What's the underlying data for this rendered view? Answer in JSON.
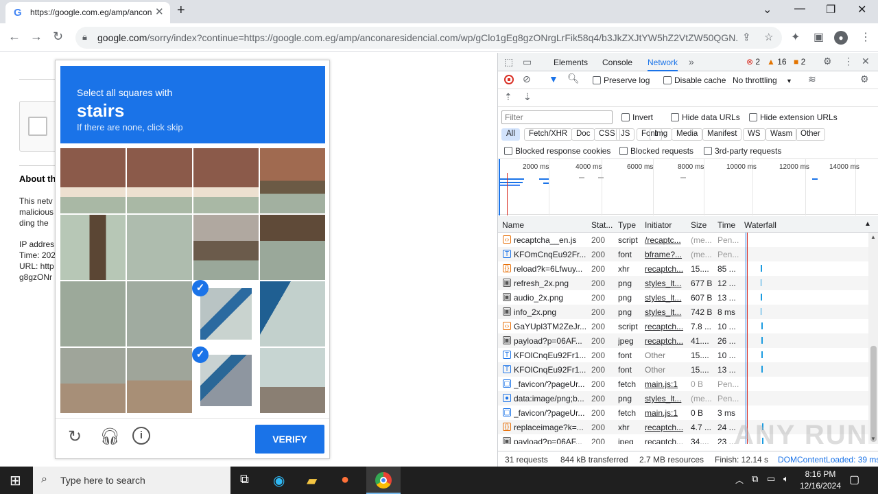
{
  "browser": {
    "tab_title": "https://google.com.eg/amp/anconaresidencial.com",
    "tab_favicon": "G",
    "url_host": "google.com",
    "url_rest": "/sorry/index?continue=https://google.com.eg/amp/anconaresidencial.com/wp/gClo1gEg8gzONrgLrFik58q4/b3JkZXJtYW5hZ2VtZW50QGN...",
    "accent": "#1a73e8"
  },
  "page": {
    "about_title": "About th",
    "lines": [
      "This netv",
      "malicious",
      "ding the",
      "IP addres",
      "Time: 202",
      "URL: http",
      "g8gzONr"
    ]
  },
  "captcha": {
    "line1": "Select all squares with",
    "keyword": "stairs",
    "line3": "If there are none, click skip",
    "verify_label": "VERIFY",
    "selected_tiles": [
      10,
      14
    ]
  },
  "devtools": {
    "tabs": [
      "Elements",
      "Console",
      "Network"
    ],
    "errors": "2",
    "warnings": "16",
    "issues": "2",
    "preserve_log": "Preserve log",
    "disable_cache": "Disable cache",
    "throttling": "No throttling",
    "filter_placeholder": "Filter",
    "invert": "Invert",
    "hide_data_urls": "Hide data URLs",
    "hide_ext_urls": "Hide extension URLs",
    "chips": [
      "All",
      "Fetch/XHR",
      "Doc",
      "CSS",
      "JS",
      "Font",
      "Img",
      "Media",
      "Manifest",
      "WS",
      "Wasm",
      "Other"
    ],
    "blocked_cookies": "Blocked response cookies",
    "blocked_requests": "Blocked requests",
    "third_party": "3rd-party requests",
    "timeline_ticks": [
      "2000 ms",
      "4000 ms",
      "6000 ms",
      "8000 ms",
      "10000 ms",
      "12000 ms",
      "14000 ms"
    ],
    "columns": [
      "Name",
      "Stat...",
      "Type",
      "Initiator",
      "Size",
      "Time",
      "Waterfall"
    ],
    "rows": [
      {
        "icon": "script",
        "name": "recaptcha__en.js",
        "status": "200",
        "type": "script",
        "initiator": "/recaptc...",
        "size": "(me...",
        "time": "Pen...",
        "link": true,
        "grey": true
      },
      {
        "icon": "font",
        "name": "KFOmCnqEu92Fr...",
        "status": "200",
        "type": "font",
        "initiator": "bframe?...",
        "size": "(me...",
        "time": "Pen...",
        "link": true,
        "grey": true
      },
      {
        "icon": "xhr",
        "name": "reload?k=6Lfwuy...",
        "status": "200",
        "type": "xhr",
        "initiator": "recaptch...",
        "size": "15....",
        "time": "85 ...",
        "link": true,
        "grey": false
      },
      {
        "icon": "img",
        "name": "refresh_2x.png",
        "status": "200",
        "type": "png",
        "initiator": "styles_lt...",
        "size": "677 B",
        "time": "12 ...",
        "link": true,
        "grey": false
      },
      {
        "icon": "img",
        "name": "audio_2x.png",
        "status": "200",
        "type": "png",
        "initiator": "styles_lt...",
        "size": "607 B",
        "time": "13 ...",
        "link": true,
        "grey": false
      },
      {
        "icon": "img",
        "name": "info_2x.png",
        "status": "200",
        "type": "png",
        "initiator": "styles_lt...",
        "size": "742 B",
        "time": "8 ms",
        "link": true,
        "grey": false
      },
      {
        "icon": "script",
        "name": "GaYUpl3TM2ZeJr...",
        "status": "200",
        "type": "script",
        "initiator": "recaptch...",
        "size": "7.8 ...",
        "time": "10 ...",
        "link": true,
        "grey": false
      },
      {
        "icon": "img",
        "name": "payload?p=06AF...",
        "status": "200",
        "type": "jpeg",
        "initiator": "recaptch...",
        "size": "41....",
        "time": "26 ...",
        "link": true,
        "grey": false
      },
      {
        "icon": "font",
        "name": "KFOlCnqEu92Fr1...",
        "status": "200",
        "type": "font",
        "initiator": "Other",
        "size": "15....",
        "time": "10 ...",
        "link": false,
        "grey": false
      },
      {
        "icon": "font",
        "name": "KFOlCnqEu92Fr1...",
        "status": "200",
        "type": "font",
        "initiator": "Other",
        "size": "15....",
        "time": "13 ...",
        "link": false,
        "grey": false
      },
      {
        "icon": "doc",
        "name": "_favicon/?pageUr...",
        "status": "200",
        "type": "fetch",
        "initiator": "main.js:1",
        "size": "0 B",
        "time": "Pen...",
        "link": true,
        "grey": true
      },
      {
        "icon": "data",
        "name": "data:image/png;b...",
        "status": "200",
        "type": "png",
        "initiator": "styles_lt...",
        "size": "(me...",
        "time": "Pen...",
        "link": true,
        "grey": true
      },
      {
        "icon": "doc",
        "name": "_favicon/?pageUr...",
        "status": "200",
        "type": "fetch",
        "initiator": "main.js:1",
        "size": "0 B",
        "time": "3 ms",
        "link": true,
        "grey": false
      },
      {
        "icon": "xhr",
        "name": "replaceimage?k=...",
        "status": "200",
        "type": "xhr",
        "initiator": "recaptch...",
        "size": "4.7 ...",
        "time": "24 ...",
        "link": true,
        "grey": false
      },
      {
        "icon": "img",
        "name": "payload?p=06AF...",
        "status": "200",
        "type": "jpeg",
        "initiator": "recaptch...",
        "size": "34....",
        "time": "23 ...",
        "link": true,
        "grey": false
      }
    ],
    "status": {
      "requests": "31 requests",
      "transferred": "844 kB transferred",
      "resources": "2.7 MB resources",
      "finish": "Finish: 12.14 s",
      "dcl": "DOMContentLoaded: 39 ms"
    }
  },
  "taskbar": {
    "search_placeholder": "Type here to search",
    "time": "8:16 PM",
    "date": "12/16/2024"
  },
  "watermark": "ANY RUN"
}
